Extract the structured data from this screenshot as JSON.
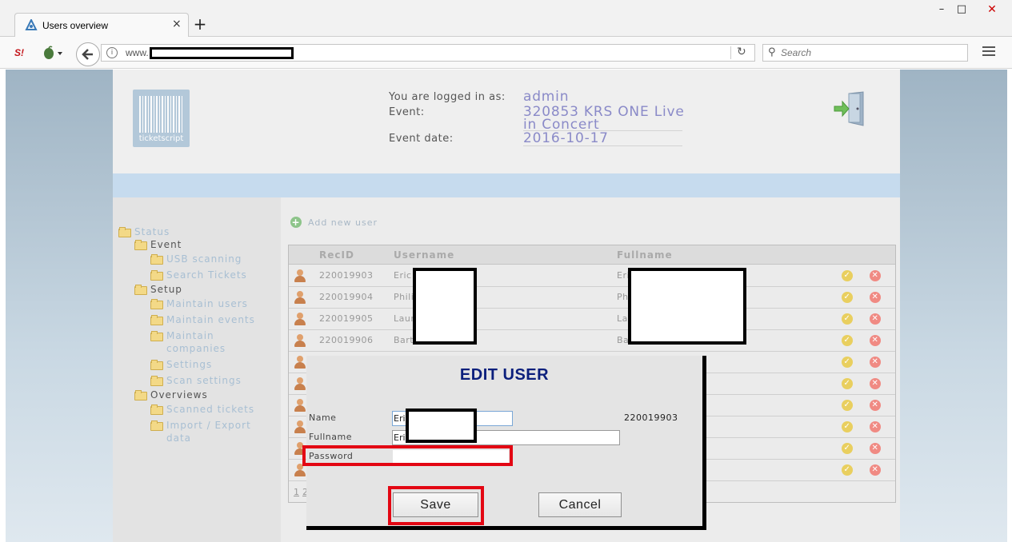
{
  "browser": {
    "tab_title": "Users overview",
    "tab_close": "×",
    "new_tab": "+",
    "window_controls": {
      "minimize": "–",
      "maximize": "□",
      "close": "✕"
    },
    "url_prefix": "www.",
    "search_placeholder": "Search",
    "logo_badge": "S!",
    "icons": [
      "tab-favicon-icon",
      "onion-icon",
      "back-arrow-icon",
      "info-icon",
      "reload-icon",
      "search-icon",
      "hamburger-menu-icon"
    ]
  },
  "header": {
    "logo_text": "ticketscript",
    "logged_in_label": "You are logged in as:",
    "logged_in_value": "admin",
    "event_label": "Event:",
    "event_value_line1": "320853 KRS ONE Live",
    "event_value_line2": "in Concert",
    "event_date_label": "Event date:",
    "event_date_value": "2016-10-17"
  },
  "sidebar": {
    "status": "Status",
    "event": "Event",
    "usb_scanning": "USB scanning",
    "search_tickets": "Search Tickets",
    "setup": "Setup",
    "maintain_users": "Maintain users",
    "maintain_events": "Maintain events",
    "maintain_companies_1": "Maintain",
    "maintain_companies_2": "companies",
    "settings": "Settings",
    "scan_settings": "Scan settings",
    "overviews": "Overviews",
    "scanned_tickets": "Scanned tickets",
    "import_export_1": "Import / Export",
    "import_export_2": "data"
  },
  "main": {
    "add_user_label": "Add new user",
    "columns": {
      "recid": "RecID",
      "username": "Username",
      "fullname": "Fullname"
    },
    "rows": [
      {
        "recid": "220019903",
        "username": "Eric",
        "fullname": "Eri"
      },
      {
        "recid": "220019904",
        "username": "Phili",
        "fullname": "Phi"
      },
      {
        "recid": "220019905",
        "username": "Laur",
        "fullname": "La"
      },
      {
        "recid": "220019906",
        "username": "Bart",
        "fullname": "Ba"
      },
      {
        "recid": "",
        "username": "",
        "fullname": ""
      },
      {
        "recid": "",
        "username": "",
        "fullname": ""
      },
      {
        "recid": "",
        "username": "",
        "fullname": ""
      },
      {
        "recid": "",
        "username": "",
        "fullname": ""
      },
      {
        "recid": "",
        "username": "",
        "fullname": ""
      },
      {
        "recid": "",
        "username": "",
        "fullname": ""
      }
    ],
    "pager": [
      "1",
      "2"
    ],
    "ok_glyph": "✓",
    "delete_glyph": "✕"
  },
  "modal": {
    "title": "EDIT USER",
    "name_label": "Name",
    "name_value": "Eri",
    "fullname_label": "Fullname",
    "fullname_value": "Eri",
    "password_label": "Password",
    "password_value": "",
    "recid": "220019903",
    "save_label": "Save",
    "cancel_label": "Cancel"
  },
  "colors": {
    "accent_value": "#8a8ac8",
    "modal_title": "#0b1f7c",
    "highlight": "#e30613",
    "blue_band": "#c6dbee"
  }
}
